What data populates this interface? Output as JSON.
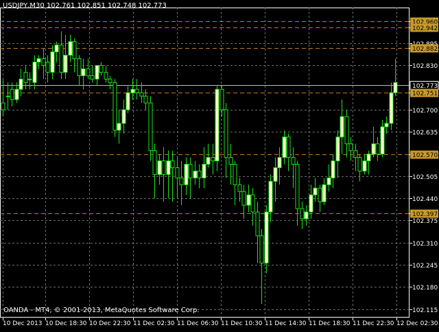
{
  "title": "USDJPY,M30  102.761 102.851 102.748 102.773",
  "copyright": "OANDA - MT4, © 2001-2013, MetaQuotes Software Corp.",
  "colors": {
    "background": "#000000",
    "grid": "#6f6f6f",
    "axis_text": "#ffffff",
    "bull_candle": "#ffffcc",
    "wick": "#19e619",
    "level_line": "#c87a1e",
    "level_label_bg": "#c89a28",
    "bid_label_bg": "#000000"
  },
  "y_ticks": [
    "102.960",
    "102.942",
    "102.895",
    "102.882",
    "102.830",
    "102.773",
    "102.751",
    "102.700",
    "102.635",
    "102.570",
    "102.505",
    "102.440",
    "102.397",
    "102.375",
    "102.310",
    "102.245",
    "102.180",
    "102.115"
  ],
  "x_ticks": [
    "10 Dec 2013",
    "10 Dec 18:30",
    "10 Dec 22:30",
    "11 Dec 02:30",
    "11 Dec 06:30",
    "11 Dec 10:30",
    "11 Dec 14:30",
    "11 Dec 18:30",
    "11 Dec 22:30",
    "12 Dec 02:30"
  ],
  "chart_data": {
    "type": "candlestick",
    "symbol": "USDJPY",
    "timeframe": "M30",
    "ylim": [
      102.09,
      103.0
    ],
    "last_price": 102.773,
    "levels": [
      {
        "value": 102.96,
        "label": "102.960"
      },
      {
        "value": 102.942,
        "label": "102.942"
      },
      {
        "value": 102.882,
        "label": "102.882"
      },
      {
        "value": 102.751,
        "label": "102.751"
      },
      {
        "value": 102.57,
        "label": "102.570"
      },
      {
        "value": 102.397,
        "label": "102.397"
      }
    ],
    "candles": [
      [
        102.72,
        102.7,
        102.79,
        102.68
      ],
      [
        102.74,
        102.74,
        102.78,
        102.7
      ],
      [
        102.76,
        102.73,
        102.78,
        102.71
      ],
      [
        102.73,
        102.76,
        102.78,
        102.72
      ],
      [
        102.76,
        102.79,
        102.82,
        102.74
      ],
      [
        102.81,
        102.78,
        102.83,
        102.76
      ],
      [
        102.79,
        102.79,
        102.81,
        102.76
      ],
      [
        102.78,
        102.84,
        102.86,
        102.76
      ],
      [
        102.84,
        102.85,
        102.86,
        102.82
      ],
      [
        102.85,
        102.83,
        102.88,
        102.79
      ],
      [
        102.84,
        102.81,
        102.86,
        102.78
      ],
      [
        102.81,
        102.87,
        102.89,
        102.79
      ],
      [
        102.87,
        102.89,
        102.9,
        102.84
      ],
      [
        102.89,
        102.81,
        102.93,
        102.79
      ],
      [
        102.81,
        102.86,
        102.92,
        102.79
      ],
      [
        102.86,
        102.9,
        102.92,
        102.84
      ],
      [
        102.9,
        102.85,
        102.91,
        102.81
      ],
      [
        102.85,
        102.8,
        102.86,
        102.77
      ],
      [
        102.8,
        102.82,
        102.85,
        102.76
      ],
      [
        102.82,
        102.8,
        102.85,
        102.79
      ],
      [
        102.8,
        102.79,
        102.83,
        102.78
      ],
      [
        102.79,
        102.83,
        102.83,
        102.77
      ],
      [
        102.83,
        102.81,
        102.84,
        102.8
      ],
      [
        102.81,
        102.79,
        102.83,
        102.78
      ],
      [
        102.79,
        102.78,
        102.8,
        102.76
      ],
      [
        102.78,
        102.64,
        102.79,
        102.62
      ],
      [
        102.64,
        102.66,
        102.7,
        102.6
      ],
      [
        102.66,
        102.7,
        102.73,
        102.63
      ],
      [
        102.7,
        102.75,
        102.77,
        102.69
      ],
      [
        102.75,
        102.76,
        102.79,
        102.73
      ],
      [
        102.76,
        102.75,
        102.79,
        102.73
      ],
      [
        102.75,
        102.74,
        102.78,
        102.72
      ],
      [
        102.74,
        102.72,
        102.76,
        102.7
      ],
      [
        102.72,
        102.58,
        102.74,
        102.55
      ],
      [
        102.58,
        102.51,
        102.6,
        102.44
      ],
      [
        102.51,
        102.55,
        102.57,
        102.48
      ],
      [
        102.55,
        102.51,
        102.59,
        102.43
      ],
      [
        102.51,
        102.55,
        102.58,
        102.44
      ],
      [
        102.55,
        102.53,
        102.58,
        102.43
      ],
      [
        102.53,
        102.5,
        102.56,
        102.44
      ],
      [
        102.5,
        102.48,
        102.55,
        102.42
      ],
      [
        102.48,
        102.54,
        102.56,
        102.45
      ],
      [
        102.54,
        102.5,
        102.56,
        102.44
      ],
      [
        102.5,
        102.52,
        102.55,
        102.48
      ],
      [
        102.52,
        102.5,
        102.54,
        102.47
      ],
      [
        102.5,
        102.54,
        102.59,
        102.47
      ],
      [
        102.54,
        102.56,
        102.6,
        102.53
      ],
      [
        102.56,
        102.55,
        102.6,
        102.51
      ],
      [
        102.55,
        102.76,
        102.77,
        102.52
      ],
      [
        102.76,
        102.7,
        102.77,
        102.68
      ],
      [
        102.7,
        102.56,
        102.72,
        102.5
      ],
      [
        102.56,
        102.54,
        102.6,
        102.48
      ],
      [
        102.54,
        102.48,
        102.55,
        102.42
      ],
      [
        102.48,
        102.46,
        102.5,
        102.43
      ],
      [
        102.46,
        102.42,
        102.48,
        102.38
      ],
      [
        102.42,
        102.45,
        102.48,
        102.4
      ],
      [
        102.45,
        102.4,
        102.47,
        102.36
      ],
      [
        102.4,
        102.33,
        102.43,
        102.25
      ],
      [
        102.33,
        102.25,
        102.35,
        102.13
      ],
      [
        102.25,
        102.4,
        102.42,
        102.22
      ],
      [
        102.4,
        102.49,
        102.51,
        102.37
      ],
      [
        102.49,
        102.53,
        102.56,
        102.43
      ],
      [
        102.53,
        102.56,
        102.59,
        102.48
      ],
      [
        102.56,
        102.62,
        102.64,
        102.54
      ],
      [
        102.62,
        102.56,
        102.63,
        102.52
      ],
      [
        102.56,
        102.54,
        102.59,
        102.47
      ],
      [
        102.54,
        102.41,
        102.55,
        102.36
      ],
      [
        102.41,
        102.38,
        102.43,
        102.35
      ],
      [
        102.38,
        102.4,
        102.42,
        102.36
      ],
      [
        102.4,
        102.45,
        102.48,
        102.38
      ],
      [
        102.45,
        102.47,
        102.5,
        102.43
      ],
      [
        102.47,
        102.43,
        102.48,
        102.4
      ],
      [
        102.43,
        102.48,
        102.5,
        102.42
      ],
      [
        102.48,
        102.5,
        102.54,
        102.46
      ],
      [
        102.5,
        102.55,
        102.57,
        102.47
      ],
      [
        102.55,
        102.62,
        102.64,
        102.5
      ],
      [
        102.62,
        102.68,
        102.73,
        102.57
      ],
      [
        102.68,
        102.6,
        102.7,
        102.56
      ],
      [
        102.6,
        102.58,
        102.62,
        102.55
      ],
      [
        102.58,
        102.56,
        102.6,
        102.52
      ],
      [
        102.56,
        102.52,
        102.57,
        102.49
      ],
      [
        102.52,
        102.55,
        102.57,
        102.51
      ],
      [
        102.55,
        102.57,
        102.58,
        102.51
      ],
      [
        102.57,
        102.6,
        102.65,
        102.56
      ],
      [
        102.6,
        102.57,
        102.62,
        102.55
      ],
      [
        102.57,
        102.65,
        102.67,
        102.56
      ],
      [
        102.65,
        102.66,
        102.68,
        102.63
      ],
      [
        102.66,
        102.75,
        102.78,
        102.64
      ],
      [
        102.75,
        102.78,
        102.85,
        102.74
      ]
    ]
  }
}
